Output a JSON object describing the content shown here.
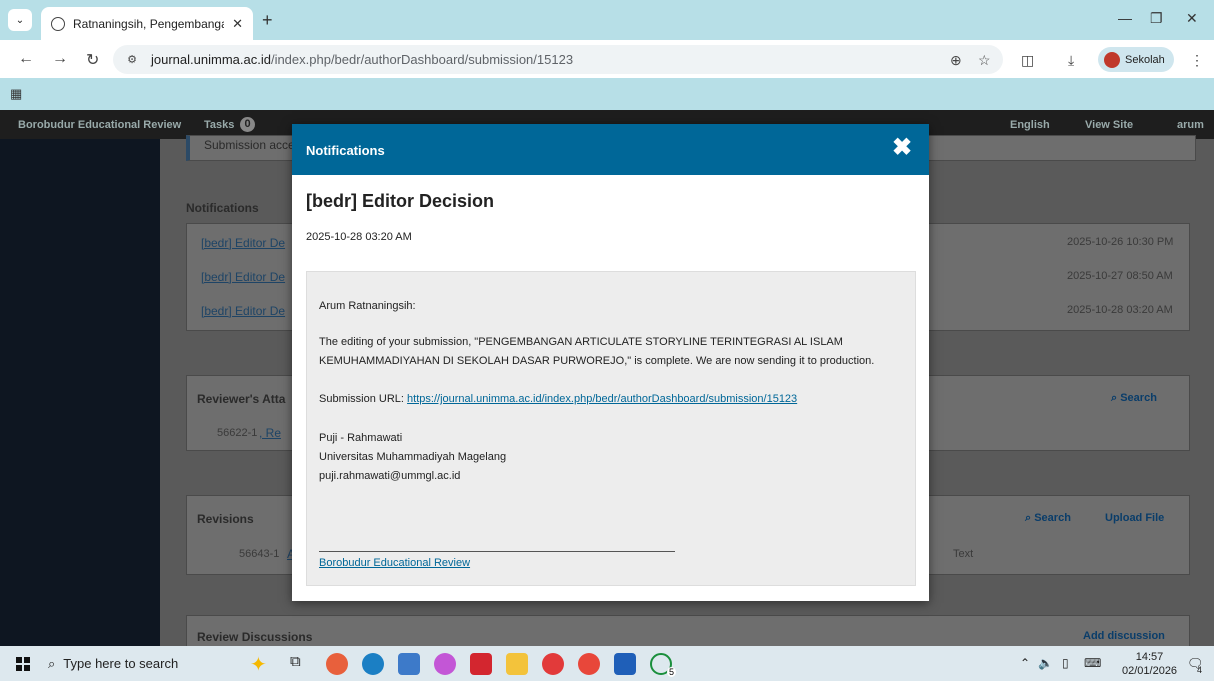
{
  "browser": {
    "tab_title": "Ratnaningsih, Pengembangan A",
    "url_domain": "journal.unimma.ac.id",
    "url_path": "/index.php/bedr/authorDashboard/submission/15123",
    "profile_label": "Sekolah"
  },
  "ojs_nav": {
    "journal": "Borobudur Educational Review",
    "tasks": "Tasks",
    "tasks_count": "0",
    "language": "English",
    "view_site": "View Site",
    "user": "arum"
  },
  "background": {
    "submission_accepted": "Submission acce",
    "notifications_heading": "Notifications",
    "notification_rows": [
      {
        "link": "[bedr] Editor De",
        "date": "2025-10-26 10:30 PM"
      },
      {
        "link": "[bedr] Editor De",
        "date": "2025-10-27 08:50 AM"
      },
      {
        "link": "[bedr] Editor De",
        "date": "2025-10-28 03:20 AM"
      }
    ],
    "reviewer_heading": "Reviewer's Atta",
    "reviewer_search": "Search",
    "reviewer_file": "56622-1",
    "reviewer_file_suffix": ", Re",
    "revisions_heading": "Revisions",
    "revisions_search": "Search",
    "upload_file": "Upload File",
    "revision_file": "56643-1",
    "revision_file_suffix": "A",
    "revision_text_tail": "Text",
    "review_discussions": "Review Discussions",
    "add_discussion": "Add discussion"
  },
  "modal": {
    "header": "Notifications",
    "title": "[bedr] Editor Decision",
    "date": "2025-10-28 03:20 AM",
    "greeting": "Arum Ratnaningsih:",
    "body_line1": "The editing of your submission, \"PENGEMBANGAN ARTICULATE STORYLINE TERINTEGRASI AL ISLAM",
    "body_line2": "KEMUHAMMADIYAHAN DI SEKOLAH DASAR PURWOREJO,\" is complete. We are now sending it to production.",
    "submission_url_label": "Submission URL:",
    "submission_url": "https://journal.unimma.ac.id/index.php/bedr/authorDashboard/submission/15123",
    "sig_name": "Puji - Rahmawati",
    "sig_org": "Universitas Muhammadiyah Magelang",
    "sig_email": "puji.rahmawati@ummgl.ac.id",
    "footer_link": "Borobudur Educational Review"
  },
  "taskbar": {
    "search_placeholder": "Type here to search",
    "time": "14:57",
    "date": "02/01/2026",
    "notification_count": "4",
    "whatsapp_badge": "5"
  },
  "colors": {
    "ojs_primary": "#006798",
    "chrome_accent": "#b7dfe7"
  }
}
